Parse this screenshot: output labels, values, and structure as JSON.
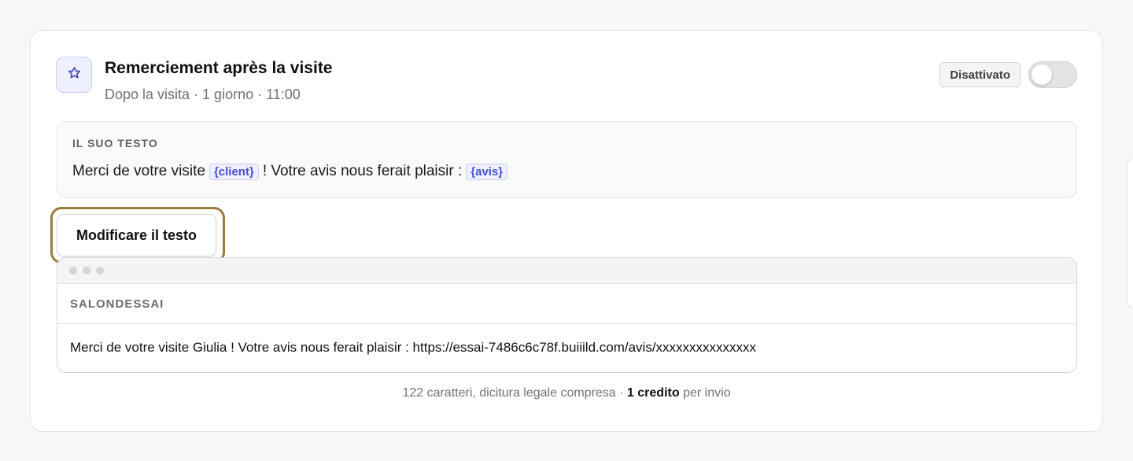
{
  "automation": {
    "title": "Remerciement après la visite",
    "subtitle": "Dopo la visita · 1 giorno · 11:00",
    "icon": "star-icon",
    "status_label": "Disattivato",
    "enabled": false
  },
  "message": {
    "label": "IL SUO TESTO",
    "parts": {
      "before_client": "Merci de votre visite",
      "client_var": "{client}",
      "middle": "! Votre avis nous ferait plaisir :",
      "avis_var": "{avis}"
    },
    "edit_button_label": "Modificare il testo"
  },
  "preview": {
    "sender": "SALONDESSAI",
    "text": "Merci de votre visite Giulia ! Votre avis nous ferait plaisir : https://essai-7486c6c78f.buiiild.com/avis/xxxxxxxxxxxxxxx"
  },
  "footer": {
    "prefix": "122 caratteri, dicitura legale compresa ·",
    "credit": "1 credito",
    "suffix": "per invio"
  },
  "colors": {
    "accent": "#4a4fd0",
    "highlight": "#9c7b3c"
  }
}
